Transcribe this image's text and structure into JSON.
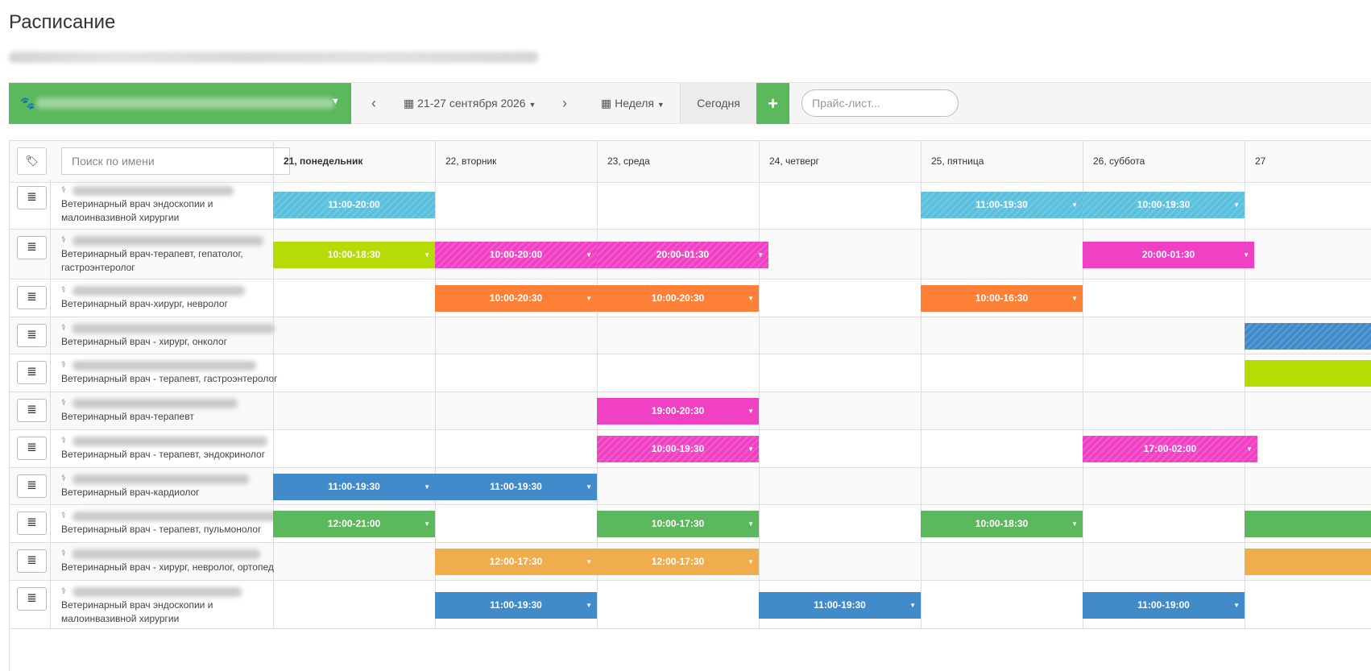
{
  "page": {
    "title": "Расписание"
  },
  "toolbar": {
    "prev_icon": "‹",
    "date_range": "21-27 сентября 2026",
    "next_icon": "›",
    "view_label": "Неделя",
    "today_label": "Сегодня",
    "add_icon": "+",
    "price_list_placeholder": "Прайс-лист..."
  },
  "grid": {
    "search_placeholder": "Поиск по имени",
    "days": [
      {
        "label": "21, понедельник",
        "today": true
      },
      {
        "label": "22, вторник"
      },
      {
        "label": "23, среда"
      },
      {
        "label": "24, четверг"
      },
      {
        "label": "25, пятница"
      },
      {
        "label": "26, суббота"
      },
      {
        "label": "27"
      }
    ],
    "doctors": [
      {
        "specialty": "Ветеринарный врач эндоскопии и малоинвазивной хирургии",
        "shifts": [
          {
            "day": 0,
            "span": 1,
            "time": "11:00-20:00",
            "color": "#5bc0de",
            "striped": true,
            "caret": false
          },
          {
            "day": 4,
            "span": 1,
            "time": "11:00-19:30",
            "color": "#5bc0de",
            "striped": true,
            "caret": true
          },
          {
            "day": 5,
            "span": 1,
            "time": "10:00-19:30",
            "color": "#5bc0de",
            "striped": true,
            "caret": true
          }
        ]
      },
      {
        "specialty": "Ветеринарный врач-терапевт, гепатолог, гастроэнтеролог",
        "shifts": [
          {
            "day": 0,
            "span": 1,
            "time": "10:00-18:30",
            "color": "#b5dd05",
            "caret": true
          },
          {
            "day": 1,
            "span": 1,
            "time": "10:00-20:00",
            "color": "#f041c5",
            "striped": true,
            "caret": true
          },
          {
            "day": 2,
            "span": 1.06,
            "time": "20:00-01:30",
            "color": "#f041c5",
            "striped": true,
            "caret": true
          },
          {
            "day": 5,
            "span": 1.06,
            "time": "20:00-01:30",
            "color": "#f041c5",
            "caret": true
          }
        ]
      },
      {
        "specialty": "Ветеринарный врач-хирург, невролог",
        "shifts": [
          {
            "day": 1,
            "span": 1,
            "time": "10:00-20:30",
            "color": "#fd8036",
            "caret": true
          },
          {
            "day": 2,
            "span": 1,
            "time": "10:00-20:30",
            "color": "#fd8036",
            "caret": true
          },
          {
            "day": 4,
            "span": 1,
            "time": "10:00-16:30",
            "color": "#fd8036",
            "caret": true
          }
        ]
      },
      {
        "specialty": "Ветеринарный врач - хирург, онколог",
        "shifts": [
          {
            "day": 6,
            "span": 1,
            "time": "",
            "color": "#428bca",
            "striped": true,
            "caret": false
          }
        ]
      },
      {
        "specialty": "Ветеринарный врач - терапевт, гастроэнтеролог",
        "shifts": [
          {
            "day": 6,
            "span": 1,
            "time": "",
            "color": "#b5dd05",
            "caret": false
          }
        ]
      },
      {
        "specialty": "Ветеринарный врач-терапевт",
        "shifts": [
          {
            "day": 2,
            "span": 1,
            "time": "19:00-20:30",
            "color": "#f041c5",
            "caret": true
          }
        ]
      },
      {
        "specialty": "Ветеринарный врач - терапевт, эндокринолог",
        "shifts": [
          {
            "day": 2,
            "span": 1,
            "time": "10:00-19:30",
            "color": "#f041c5",
            "striped": true,
            "caret": true
          },
          {
            "day": 5,
            "span": 1.08,
            "time": "17:00-02:00",
            "color": "#f041c5",
            "striped": true,
            "caret": true
          }
        ]
      },
      {
        "specialty": "Ветеринарный врач-кардиолог",
        "shifts": [
          {
            "day": 0,
            "span": 1,
            "time": "11:00-19:30",
            "color": "#428bca",
            "caret": true
          },
          {
            "day": 1,
            "span": 1,
            "time": "11:00-19:30",
            "color": "#428bca",
            "caret": true
          }
        ]
      },
      {
        "specialty": "Ветеринарный врач - терапевт, пульмонолог",
        "shifts": [
          {
            "day": 0,
            "span": 1,
            "time": "12:00-21:00",
            "color": "#5cb85c",
            "caret": true
          },
          {
            "day": 2,
            "span": 1,
            "time": "10:00-17:30",
            "color": "#5cb85c",
            "caret": true
          },
          {
            "day": 4,
            "span": 1,
            "time": "10:00-18:30",
            "color": "#5cb85c",
            "caret": true
          },
          {
            "day": 6,
            "span": 1,
            "time": "",
            "color": "#5cb85c",
            "caret": false
          }
        ]
      },
      {
        "specialty": "Ветеринарный врач - хирург, невролог, ортопед",
        "shifts": [
          {
            "day": 1,
            "span": 1,
            "time": "12:00-17:30",
            "color": "#f0ad4e",
            "caret": true
          },
          {
            "day": 2,
            "span": 1,
            "time": "12:00-17:30",
            "color": "#f0ad4e",
            "caret": true
          },
          {
            "day": 6,
            "span": 1,
            "time": "",
            "color": "#f0ad4e",
            "caret": false
          }
        ]
      },
      {
        "specialty": "Ветеринарный врач эндоскопии и малоинвазивной хирургии",
        "shifts": [
          {
            "day": 1,
            "span": 1,
            "time": "11:00-19:30",
            "color": "#428bca",
            "caret": true
          },
          {
            "day": 3,
            "span": 1,
            "time": "11:00-19:30",
            "color": "#428bca",
            "caret": true
          },
          {
            "day": 5,
            "span": 1,
            "time": "11:00-19:00",
            "color": "#428bca",
            "caret": true
          }
        ]
      }
    ]
  }
}
